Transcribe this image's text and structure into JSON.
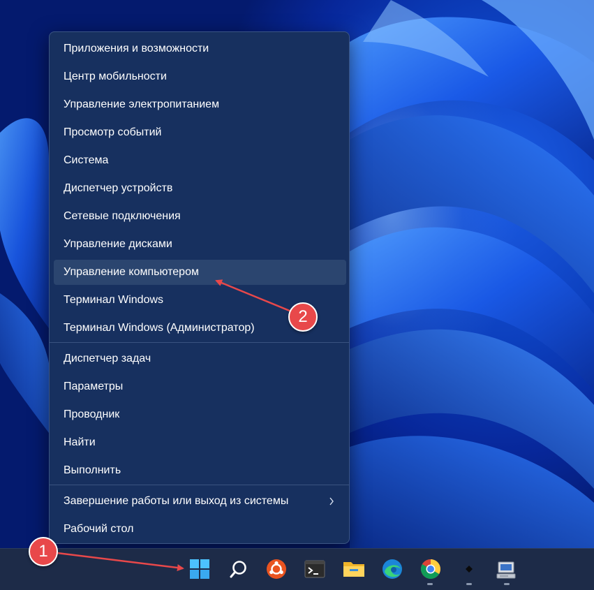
{
  "menu": {
    "items": [
      {
        "label": "Приложения и возможности"
      },
      {
        "label": "Центр мобильности"
      },
      {
        "label": "Управление электропитанием"
      },
      {
        "label": "Просмотр событий"
      },
      {
        "label": "Система"
      },
      {
        "label": "Диспетчер устройств"
      },
      {
        "label": "Сетевые подключения"
      },
      {
        "label": "Управление дисками"
      },
      {
        "label": "Управление компьютером"
      },
      {
        "label": "Терминал Windows"
      },
      {
        "label": "Терминал Windows (Администратор)"
      },
      {
        "label": "Диспетчер задач"
      },
      {
        "label": "Параметры"
      },
      {
        "label": "Проводник"
      },
      {
        "label": "Найти"
      },
      {
        "label": "Выполнить"
      },
      {
        "label": "Завершение работы или выход из системы"
      },
      {
        "label": "Рабочий стол"
      }
    ],
    "highlighted_item": "Управление компьютером",
    "submenu_icon": "chevron-right-icon"
  },
  "annotations": {
    "badge_1": "1",
    "badge_2": "2",
    "color": "#e8484a"
  },
  "taskbar": {
    "icons": [
      "windows-start-icon",
      "search-icon",
      "ubuntu-icon",
      "terminal-icon",
      "file-explorer-icon",
      "edge-icon",
      "chrome-icon",
      "app-icon",
      "network-computer-icon"
    ]
  },
  "colors": {
    "menu_bg": "#17305f",
    "highlight": "#2b456f",
    "taskbar_bg": "#1d2b48",
    "wallpaper_blue": "#0c3fbd"
  }
}
